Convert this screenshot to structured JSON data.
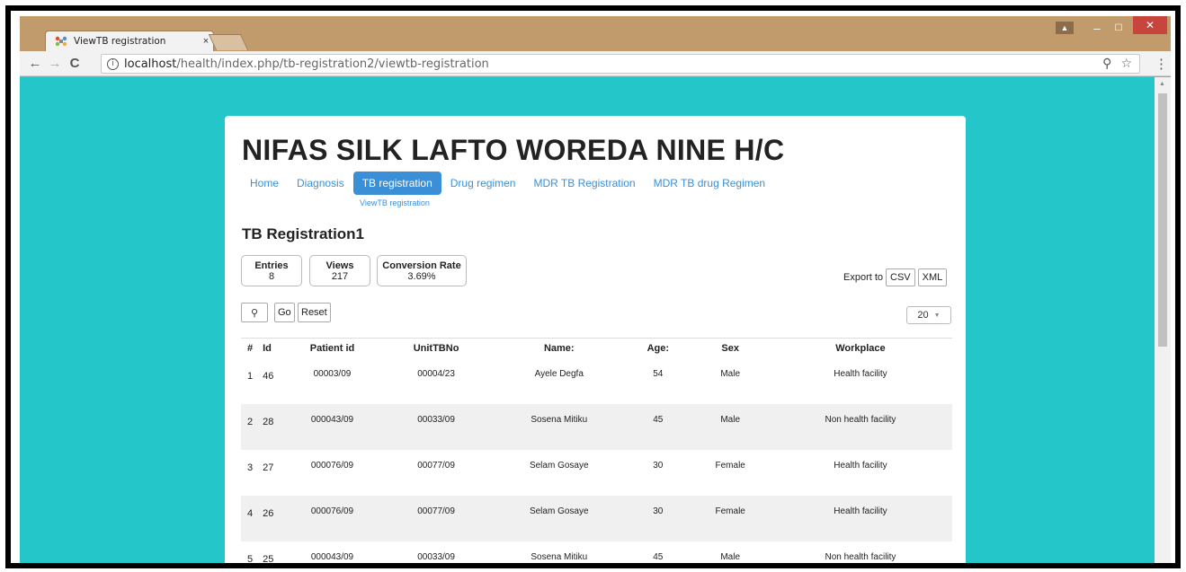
{
  "browser": {
    "tab_title": "ViewTB registration",
    "tab_close": "×",
    "url_host": "localhost",
    "url_path": "/health/index.php/tb-registration2/viewtb-registration",
    "controls": {
      "user": "▲",
      "minimize": "–",
      "maximize": "☐",
      "close": "✕"
    },
    "nav": {
      "back": "←",
      "forward": "→",
      "reload": "C"
    },
    "info_icon": "i",
    "zoom_icon": "⚲",
    "star_icon": "☆",
    "menu_icon": "⋮"
  },
  "page": {
    "site_title": "NIFAS SILK LAFTO WOREDA NINE H/C",
    "nav_items": [
      "Home",
      "Diagnosis",
      "TB registration",
      "Drug regimen",
      "MDR TB Registration",
      "MDR TB drug Regimen"
    ],
    "subnav": "ViewTB registration",
    "section_title": "TB Registration1",
    "stats": {
      "entries_label": "Entries",
      "entries_value": "8",
      "views_label": "Views",
      "views_value": "217",
      "conversion_label": "Conversion Rate",
      "conversion_value": "3.69%"
    },
    "export": {
      "label": "Export to",
      "csv": "CSV",
      "xml": "XML"
    },
    "search": {
      "go": "Go",
      "reset": "Reset",
      "search_icon": "⚲"
    },
    "per_page": "20",
    "table": {
      "headers": [
        "#",
        "Id",
        "Patient id",
        "UnitTBNo",
        "Name:",
        "Age:",
        "Sex",
        "Workplace"
      ],
      "rows": [
        [
          "1",
          "46",
          "00003/09",
          "00004/23",
          "Ayele Degfa",
          "54",
          "Male",
          "Health facility"
        ],
        [
          "2",
          "28",
          "000043/09",
          "00033/09",
          "Sosena Mitiku",
          "45",
          "Male",
          "Non health facility"
        ],
        [
          "3",
          "27",
          "000076/09",
          "00077/09",
          "Selam Gosaye",
          "30",
          "Female",
          "Health facility"
        ],
        [
          "4",
          "26",
          "000076/09",
          "00077/09",
          "Selam Gosaye",
          "30",
          "Female",
          "Health facility"
        ],
        [
          "5",
          "25",
          "000043/09",
          "00033/09",
          "Sosena Mitiku",
          "45",
          "Male",
          "Non health facility"
        ]
      ]
    }
  },
  "colors": {
    "accent": "#3a8fd6",
    "background": "#24c6c9",
    "chrome": "#c29b6c",
    "close": "#c9443c"
  }
}
